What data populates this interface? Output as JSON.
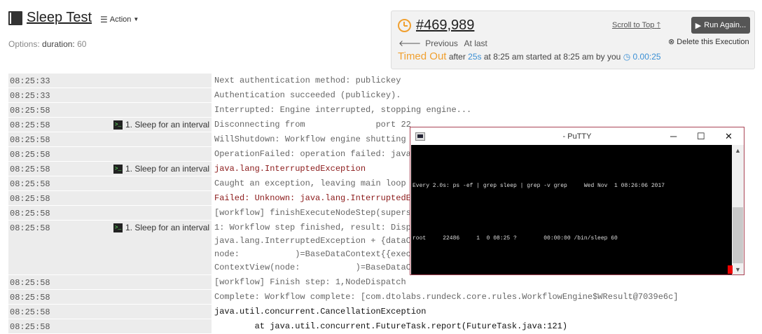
{
  "header": {
    "job_name": "Sleep Test",
    "action_label": "Action",
    "options_label": "Options:",
    "option_name": "duration:",
    "option_value": "60"
  },
  "execution": {
    "number": "#469,989",
    "previous": "Previous",
    "at_last": "At last",
    "status": "Timed Out",
    "after": "after",
    "duration": "25s",
    "at_time": "at 8:25 am",
    "started": "started",
    "started_time": "at 8:25 am",
    "by_you": "by you",
    "elapsed": "0.00:25",
    "scroll_to_top": "Scroll to Top",
    "run_again": "Run Again...",
    "delete": "Delete this Execution"
  },
  "log_rows": [
    {
      "time": "08:25:33",
      "step": "",
      "msg": "Next authentication method: publickey",
      "kind": "info"
    },
    {
      "time": "08:25:33",
      "step": "",
      "msg": "Authentication succeeded (publickey).",
      "kind": "info"
    },
    {
      "time": "08:25:58",
      "step": "",
      "msg": "Interrupted: Engine interrupted, stopping engine...",
      "kind": "info"
    },
    {
      "time": "08:25:58",
      "step": "1. Sleep for an interval",
      "msg": "Disconnecting from              port 22",
      "kind": "info"
    },
    {
      "time": "08:25:58",
      "step": "",
      "msg": "WillShutdown: Workflow engine shutting",
      "kind": "info"
    },
    {
      "time": "08:25:58",
      "step": "",
      "msg": "OperationFailed: operation failed: java",
      "kind": "info"
    },
    {
      "time": "08:25:58",
      "step": "1. Sleep for an interval",
      "msg": "java.lang.InterruptedException",
      "kind": "err"
    },
    {
      "time": "08:25:58",
      "step": "",
      "msg": "Caught an exception, leaving main loop",
      "kind": "info"
    },
    {
      "time": "08:25:58",
      "step": "",
      "msg": "Failed: Unknown: java.lang.InterruptedE",
      "kind": "err"
    },
    {
      "time": "08:25:58",
      "step": "",
      "msg": "[workflow] finishExecuteNodeStep(supers",
      "kind": "info"
    },
    {
      "time": "08:25:58",
      "step": "1. Sleep for an interval",
      "msg": "1: Workflow step finished, result: Disp\njava.lang.InterruptedException + {dataC\nnode:           )=BaseDataContext{{exec\nContextView(node:           )=BaseDataC",
      "kind": "info"
    },
    {
      "time": "08:25:58",
      "step": "",
      "msg": "[workflow] Finish step: 1,NodeDispatch",
      "kind": "info"
    },
    {
      "time": "08:25:58",
      "step": "",
      "msg": "Complete: Workflow complete: [com.dtolabs.rundeck.core.rules.WorkflowEngine$WResult@7039e6c]",
      "kind": "info"
    },
    {
      "time": "08:25:58",
      "step": "",
      "msg": "java.util.concurrent.CancellationException",
      "kind": "dark"
    },
    {
      "time": "08:25:58",
      "step": "",
      "msg": "        at java.util.concurrent.FutureTask.report(FutureTask.java:121)",
      "kind": "dark"
    }
  ],
  "putty": {
    "title": "- PuTTY",
    "line1": "Every 2.0s: ps -ef | grep sleep | grep -v grep     Wed Nov  1 08:26:06 2017",
    "line2": "root     22486     1  0 08:25 ?        00:00:00 /bin/sleep 60",
    "minimize": "─",
    "maximize": "☐",
    "close": "✕"
  }
}
